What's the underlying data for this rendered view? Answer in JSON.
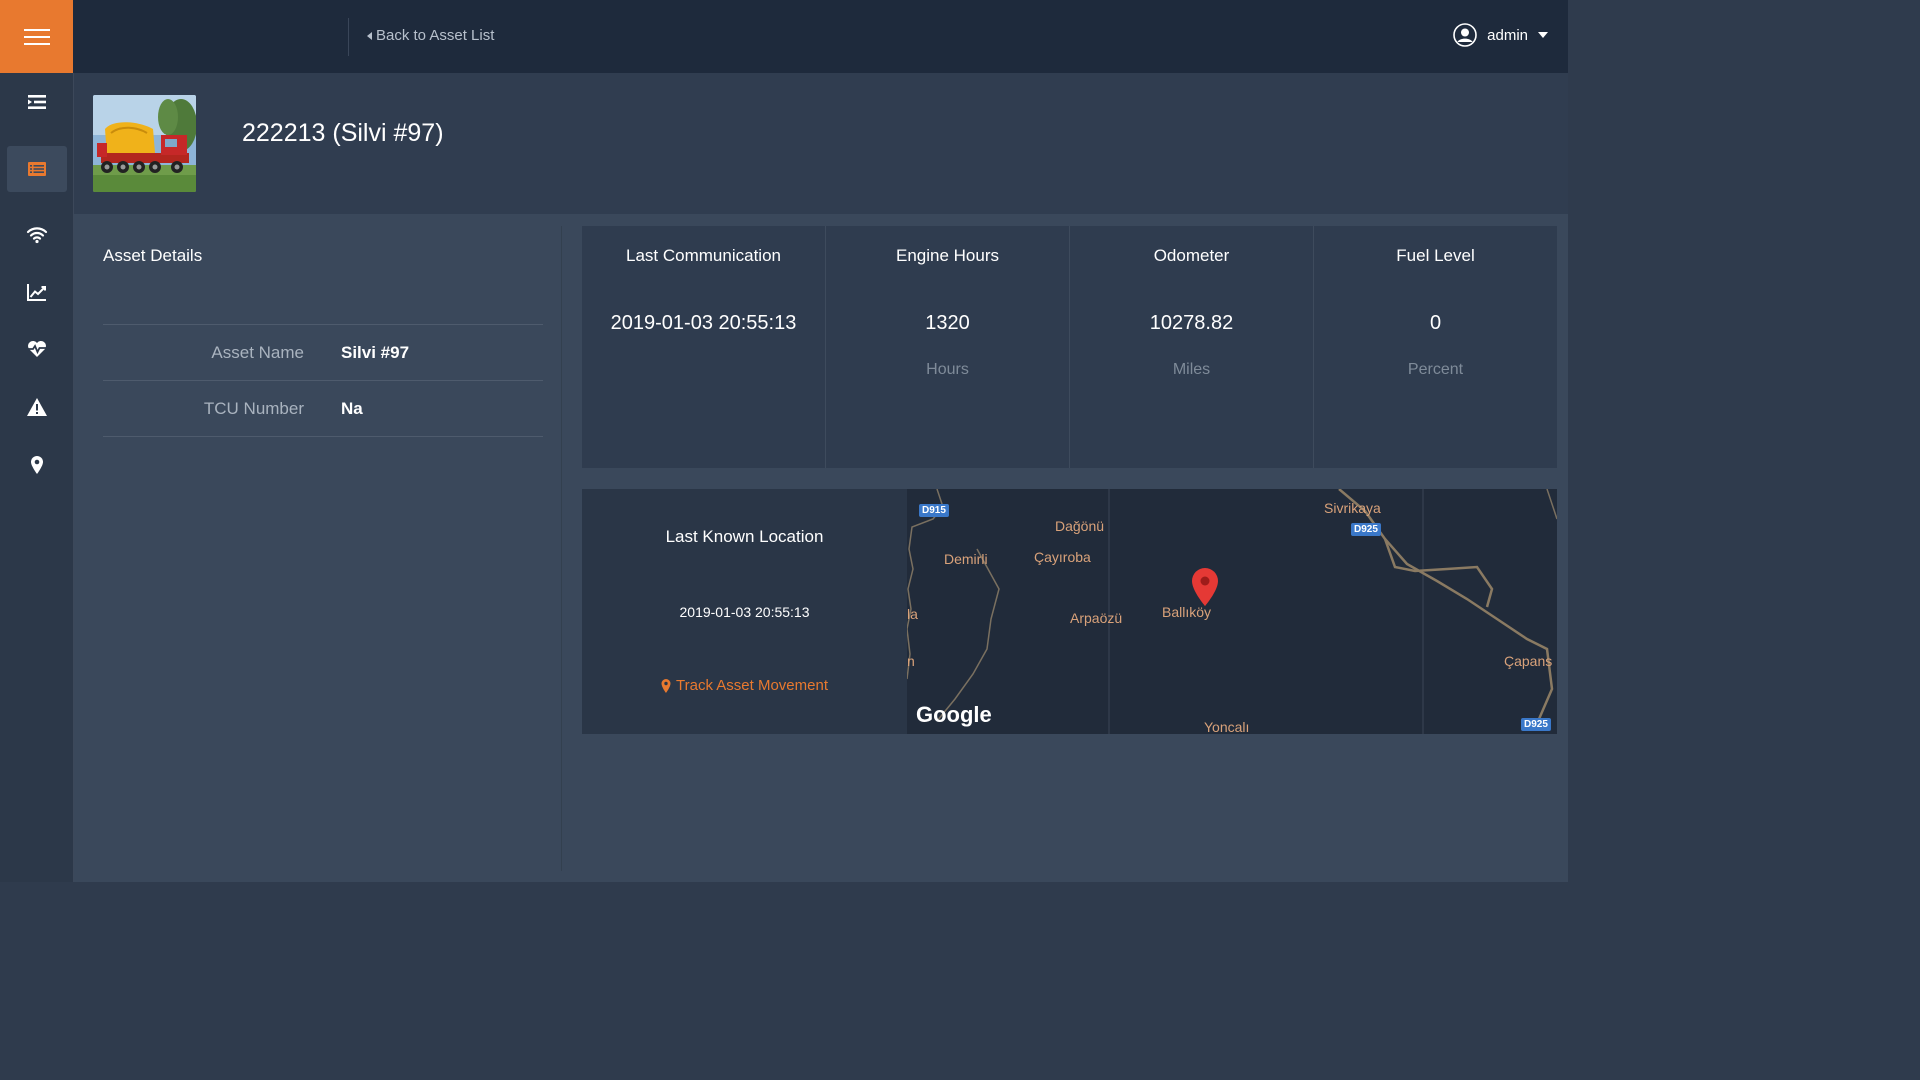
{
  "topbar": {
    "back_label": "Back to Asset List",
    "user_name": "admin"
  },
  "sidebar": {
    "items": [
      {
        "icon": "list-indent-icon"
      },
      {
        "icon": "asset-list-icon",
        "active": true
      },
      {
        "icon": "wifi-icon"
      },
      {
        "icon": "chart-line-icon"
      },
      {
        "icon": "heartbeat-icon"
      },
      {
        "icon": "warning-icon"
      },
      {
        "icon": "map-marker-icon"
      }
    ]
  },
  "asset": {
    "title": "222213 (Silvi #97)"
  },
  "details": {
    "title": "Asset Details",
    "rows": [
      {
        "label": "Asset Name",
        "value": "Silvi #97"
      },
      {
        "label": "TCU Number",
        "value": "Na"
      }
    ]
  },
  "stats": [
    {
      "label": "Last Communication",
      "value": "2019-01-03 20:55:13",
      "unit": ""
    },
    {
      "label": "Engine Hours",
      "value": "1320",
      "unit": "Hours"
    },
    {
      "label": "Odometer",
      "value": "10278.82",
      "unit": "Miles"
    },
    {
      "label": "Fuel Level",
      "value": "0",
      "unit": "Percent"
    }
  ],
  "location": {
    "title": "Last Known Location",
    "time": "2019-01-03 20:55:13",
    "track_label": "Track Asset Movement"
  },
  "map": {
    "places": [
      "Dağönü",
      "Demirli",
      "Çayıroba",
      "Arpaözü",
      "Ballıköy",
      "Sivrikaya",
      "Çapans",
      "Yoncalı",
      "la",
      "n"
    ],
    "shields": [
      "D915",
      "D925",
      "D925"
    ],
    "attribution": "Google"
  },
  "colors": {
    "accent": "#e8792f",
    "topbar": "#1e2a3c",
    "content": "#3a485b",
    "pin": "#e53935"
  }
}
